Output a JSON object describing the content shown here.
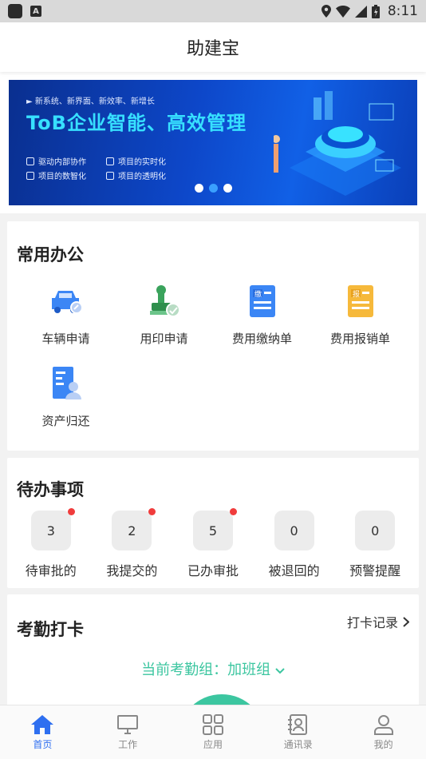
{
  "status_bar": {
    "time": "8:11",
    "a_icon": "A"
  },
  "app": {
    "title": "助建宝"
  },
  "banner": {
    "tag": "► 新系统、新界面、新效率、新增长",
    "headline": "ToB企业智能、高效管理",
    "features": [
      "驱动内部协作",
      "项目的实时化",
      "项目的数智化",
      "项目的透明化"
    ],
    "dots": 3,
    "active_dot": 1
  },
  "office": {
    "title": "常用办公",
    "items": [
      {
        "label": "车辆申请",
        "icon": "car-icon"
      },
      {
        "label": "用印申请",
        "icon": "seal-icon"
      },
      {
        "label": "费用缴纳单",
        "icon": "payment-form-icon",
        "badge": "缴"
      },
      {
        "label": "费用报销单",
        "icon": "reimburse-form-icon",
        "badge": "报"
      },
      {
        "label": "资产归还",
        "icon": "asset-return-icon"
      }
    ]
  },
  "todo": {
    "title": "待办事项",
    "items": [
      {
        "count": "3",
        "label": "待审批的",
        "dot": true
      },
      {
        "count": "2",
        "label": "我提交的",
        "dot": true
      },
      {
        "count": "5",
        "label": "已办审批",
        "dot": true
      },
      {
        "count": "0",
        "label": "被退回的",
        "dot": false
      },
      {
        "count": "0",
        "label": "预警提醒",
        "dot": false
      }
    ]
  },
  "attendance": {
    "title": "考勤打卡",
    "record_link": "打卡记录",
    "group_line": "当前考勤组：加班组"
  },
  "tabs": [
    {
      "label": "首页",
      "icon": "home-icon",
      "active": true
    },
    {
      "label": "工作",
      "icon": "monitor-icon",
      "active": false
    },
    {
      "label": "应用",
      "icon": "grid-icon",
      "active": false
    },
    {
      "label": "通讯录",
      "icon": "contacts-icon",
      "active": false
    },
    {
      "label": "我的",
      "icon": "profile-icon",
      "active": false
    }
  ],
  "colors": {
    "accent": "#2e6ff0",
    "green": "#3cc6a0",
    "red_dot": "#f03c3c"
  }
}
